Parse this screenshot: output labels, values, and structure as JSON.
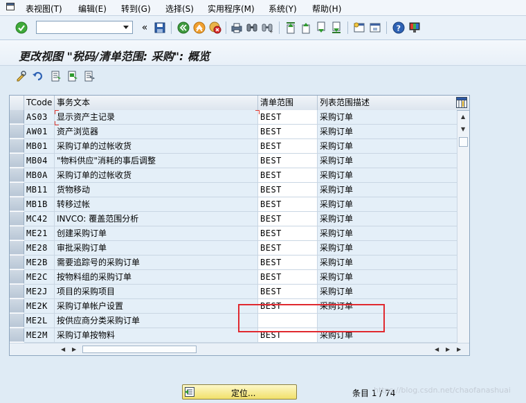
{
  "menu": [
    "表视图(T)",
    "编辑(E)",
    "转到(G)",
    "选择(S)",
    "实用程序(M)",
    "系统(Y)",
    "帮助(H)"
  ],
  "toolbar": {
    "command_value": "",
    "icons": [
      "enter-icon",
      "command-field",
      "collapse-icon",
      "save-icon",
      "back-icon",
      "exit-icon",
      "cancel-icon",
      "print-icon",
      "find-icon",
      "find-next-icon",
      "first-page-icon",
      "previous-page-icon",
      "next-page-icon",
      "last-page-icon",
      "create-session-icon",
      "shortcut-icon",
      "help-icon",
      "customize-layout-icon"
    ]
  },
  "title": "更改视图 \"税码/清单范围: 采购\": 概览",
  "app_toolbar": [
    "change-display-icon",
    "undo-icon",
    "select-all-icon",
    "select-block-icon",
    "deselect-all-icon"
  ],
  "table": {
    "columns": [
      "TCode",
      "事务文本",
      "清单范围",
      "列表范围描述"
    ],
    "rows": [
      {
        "tcode": "AS03",
        "text": "显示资产主记录",
        "scope": "BEST",
        "desc": "采购订单"
      },
      {
        "tcode": "AW01",
        "text": "资产浏览器",
        "scope": "BEST",
        "desc": "采购订单"
      },
      {
        "tcode": "MB01",
        "text": "采购订单的过帐收货",
        "scope": "BEST",
        "desc": "采购订单"
      },
      {
        "tcode": "MB04",
        "text": "\"物料供应\"消耗的事后调整",
        "scope": "BEST",
        "desc": "采购订单"
      },
      {
        "tcode": "MB0A",
        "text": "采购订单的过帐收货",
        "scope": "BEST",
        "desc": "采购订单"
      },
      {
        "tcode": "MB11",
        "text": "货物移动",
        "scope": "BEST",
        "desc": "采购订单"
      },
      {
        "tcode": "MB1B",
        "text": "转移过帐",
        "scope": "BEST",
        "desc": "采购订单"
      },
      {
        "tcode": "MC42",
        "text": "INVCO: 覆盖范围分析",
        "scope": "BEST",
        "desc": "采购订单"
      },
      {
        "tcode": "ME21",
        "text": "创建采购订单",
        "scope": "BEST",
        "desc": "采购订单"
      },
      {
        "tcode": "ME28",
        "text": "审批采购订单",
        "scope": "BEST",
        "desc": "采购订单"
      },
      {
        "tcode": "ME2B",
        "text": "需要追踪号的采购订单",
        "scope": "BEST",
        "desc": "采购订单"
      },
      {
        "tcode": "ME2C",
        "text": "按物料组的采购订单",
        "scope": "BEST",
        "desc": "采购订单"
      },
      {
        "tcode": "ME2J",
        "text": "项目的采购项目",
        "scope": "BEST",
        "desc": "采购订单"
      },
      {
        "tcode": "ME2K",
        "text": "采购订单帐户设置",
        "scope": "BEST",
        "desc": "采购订单"
      },
      {
        "tcode": "ME2L",
        "text": "按供应商分类采购订单",
        "scope": "",
        "desc": ""
      },
      {
        "tcode": "ME2M",
        "text": "采购订单按物料",
        "scope": "BEST",
        "desc": "采购订单"
      }
    ]
  },
  "position_button": "定位...",
  "entry_counter": "条目 1 / 74",
  "watermark": "https://blog.csdn.net/chaofanashuai",
  "colors": {
    "accent_yellow": "#f1e06a",
    "annotation_red": "#e0282e",
    "table_row": "#e4eff8"
  }
}
